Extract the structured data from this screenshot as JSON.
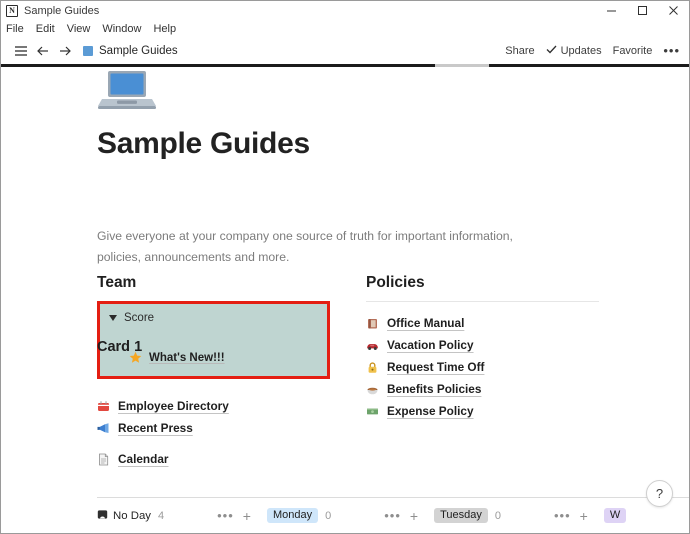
{
  "window": {
    "title": "Sample Guides",
    "app_icon": "notion-icon",
    "controls": {
      "minimize": "minimize-icon",
      "maximize": "maximize-icon",
      "close": "close-icon"
    }
  },
  "menubar": {
    "items": [
      "File",
      "Edit",
      "View",
      "Window",
      "Help"
    ]
  },
  "toolbar": {
    "menu_icon": "hamburger-icon",
    "back_icon": "arrow-left-icon",
    "forward_icon": "arrow-right-icon",
    "breadcrumb": "Sample Guides",
    "share_label": "Share",
    "updates_label": "Updates",
    "updates_check": "check-icon",
    "favorite_label": "Favorite",
    "more_label": "•••"
  },
  "page": {
    "icon": "laptop-emoji",
    "title": "Sample Guides",
    "description": "Give everyone at your company one source of truth for important information, policies, announcements and more."
  },
  "team": {
    "heading": "Team",
    "toggle": {
      "caret": "triangle-down-icon",
      "label": "Score",
      "child_icon": "star-emoji",
      "child_label": "What's New!!!",
      "background_color": "#bfd5d1",
      "highlight_border_color": "#e41e12"
    },
    "links": [
      {
        "icon": "card-index-emoji",
        "label": "Employee Directory"
      },
      {
        "icon": "megaphone-emoji",
        "label": "Recent Press"
      },
      {
        "icon": "page-emoji",
        "label": "Calendar"
      }
    ]
  },
  "policies": {
    "heading": "Policies",
    "links": [
      {
        "icon": "book-emoji",
        "label": "Office Manual"
      },
      {
        "icon": "car-emoji",
        "label": "Vacation Policy"
      },
      {
        "icon": "lock-emoji",
        "label": "Request Time Off"
      },
      {
        "icon": "stew-emoji",
        "label": "Benefits Policies"
      },
      {
        "icon": "money-emoji",
        "label": "Expense Policy"
      }
    ]
  },
  "card_section": {
    "heading": "Card 1"
  },
  "board": {
    "columns": [
      {
        "icon": "no-day-icon",
        "label": "No Day",
        "count": "4",
        "pill": "none"
      },
      {
        "label": "Monday",
        "count": "0",
        "pill": "blue"
      },
      {
        "label": "Tuesday",
        "count": "0",
        "pill": "grey"
      },
      {
        "label": "W",
        "count": "",
        "pill": "purple"
      }
    ],
    "actions": {
      "more": "•••",
      "add": "+"
    }
  },
  "help": {
    "label": "?"
  },
  "colors": {
    "accent_blue": "#5b9bd5",
    "highlight_red": "#e41e12",
    "toggle_bg": "#bfd5d1",
    "pill_blue": "#cfe6fa",
    "pill_grey": "#d3d3d3",
    "pill_purple": "#ded3f5"
  }
}
